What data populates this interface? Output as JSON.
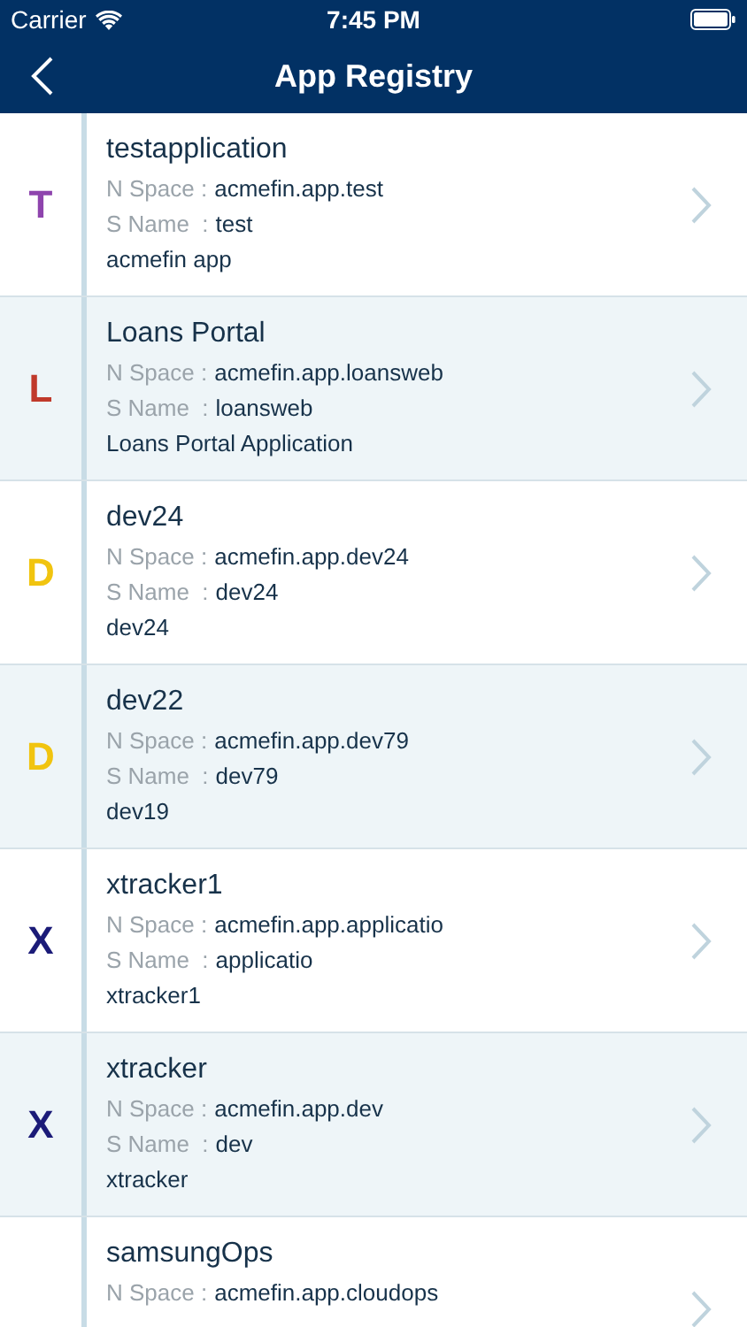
{
  "status_bar": {
    "carrier": "Carrier",
    "time": "7:45 PM"
  },
  "nav": {
    "title": "App Registry"
  },
  "apps": [
    {
      "initial": "T",
      "color": "#8e44ad",
      "name": "testapplication",
      "namespace_label": "N Space :",
      "namespace": "acmefin.app.test",
      "short_label": "S Name  :",
      "short_name": "test",
      "description": "acmefin app"
    },
    {
      "initial": "L",
      "color": "#c0392b",
      "name": "Loans Portal",
      "namespace_label": "N Space :",
      "namespace": "acmefin.app.loansweb",
      "short_label": "S Name  :",
      "short_name": "loansweb",
      "description": "Loans Portal Application"
    },
    {
      "initial": "D",
      "color": "#f1c40f",
      "name": "dev24",
      "namespace_label": "N Space :",
      "namespace": "acmefin.app.dev24",
      "short_label": "S Name  :",
      "short_name": "dev24",
      "description": "dev24"
    },
    {
      "initial": "D",
      "color": "#f1c40f",
      "name": "dev22",
      "namespace_label": "N Space :",
      "namespace": "acmefin.app.dev79",
      "short_label": "S Name  :",
      "short_name": "dev79",
      "description": "dev19"
    },
    {
      "initial": "X",
      "color": "#1b1b78",
      "name": "xtracker1",
      "namespace_label": "N Space :",
      "namespace": "acmefin.app.applicatio",
      "short_label": "S Name  :",
      "short_name": "applicatio",
      "description": "xtracker1"
    },
    {
      "initial": "X",
      "color": "#1b1b78",
      "name": "xtracker",
      "namespace_label": "N Space :",
      "namespace": "acmefin.app.dev",
      "short_label": "S Name  :",
      "short_name": "dev",
      "description": "xtracker"
    },
    {
      "name": "samsungOps",
      "namespace_label": "N Space :",
      "namespace": "acmefin.app.cloudops"
    }
  ]
}
